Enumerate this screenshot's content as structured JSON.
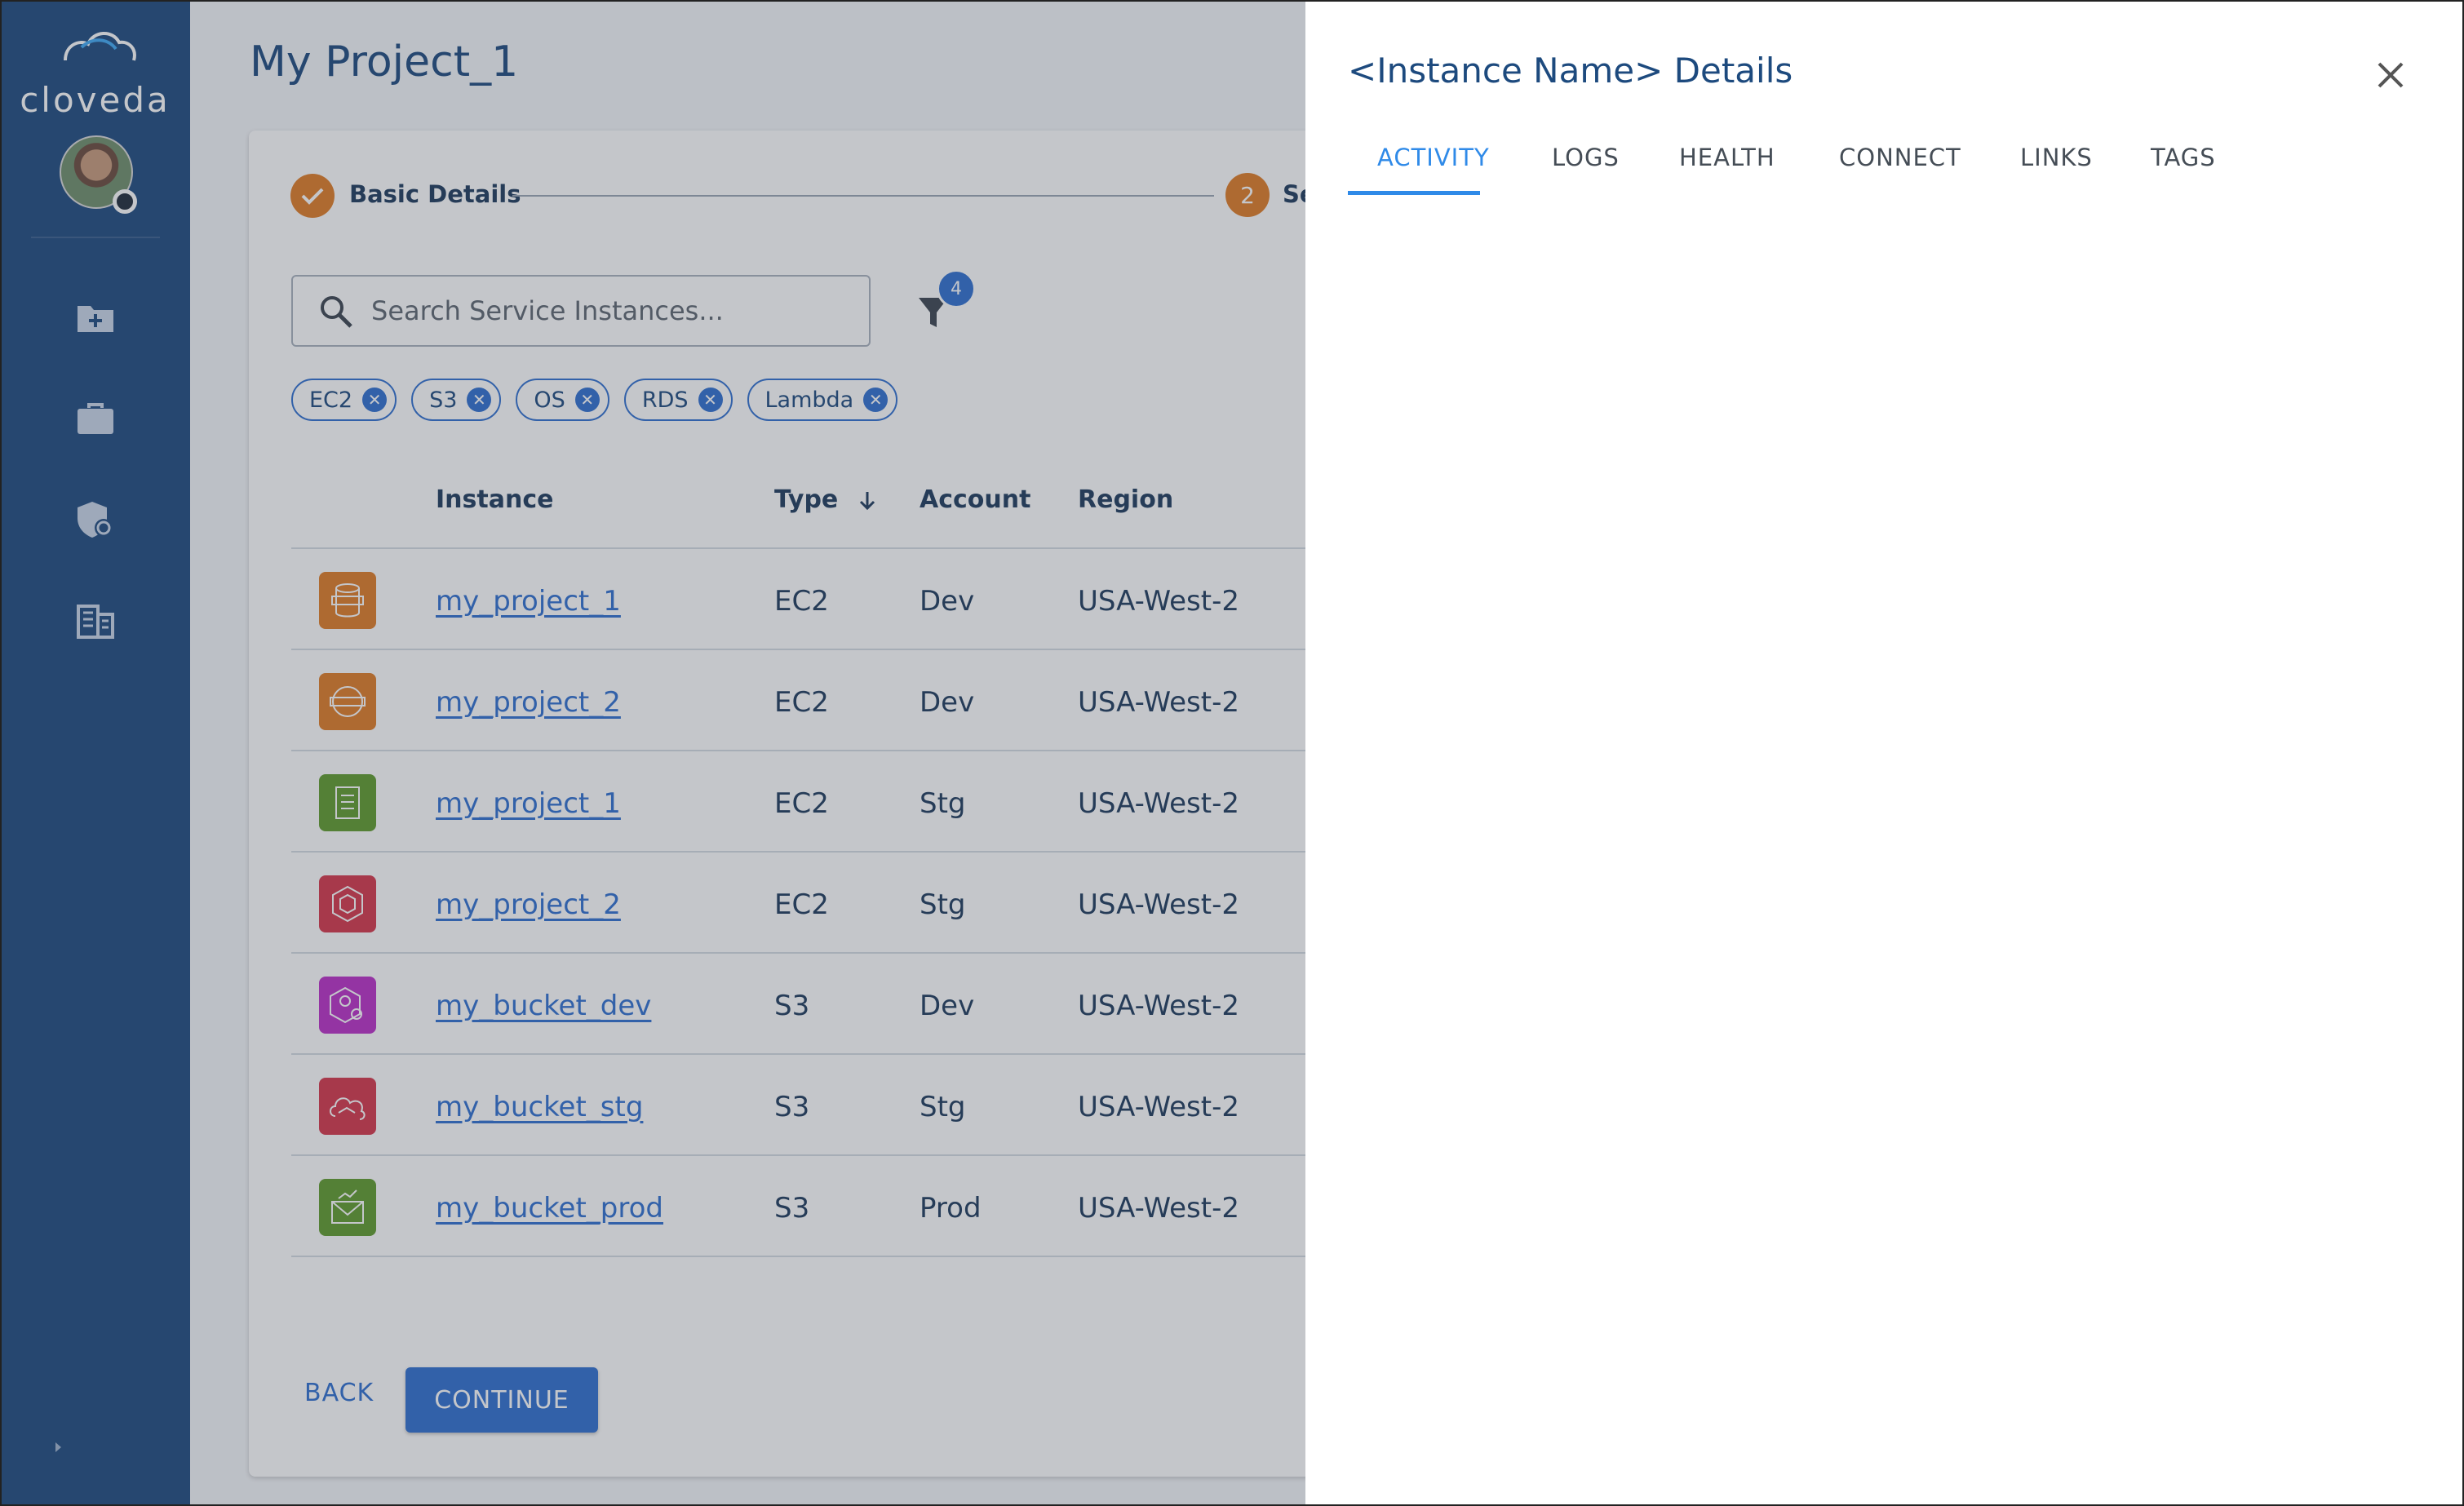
{
  "app": {
    "brand": "cloveda",
    "page_title": "My Project_1"
  },
  "stepper": {
    "step1_label": "Basic Details",
    "step2_number": "2",
    "step2_label": "Se"
  },
  "search": {
    "placeholder": "Search Service Instances..."
  },
  "filter": {
    "badge_count": "4"
  },
  "chips": [
    {
      "label": "EC2"
    },
    {
      "label": "S3"
    },
    {
      "label": "OS"
    },
    {
      "label": "RDS"
    },
    {
      "label": "Lambda"
    }
  ],
  "table": {
    "columns": {
      "instance": "Instance",
      "type": "Type",
      "account": "Account",
      "region": "Region"
    },
    "rows": [
      {
        "instance": "my_project_1",
        "type": "EC2",
        "account": "Dev",
        "region": "USA-West-2",
        "icon": "database-icon",
        "color": "#e07b25"
      },
      {
        "instance": "my_project_2",
        "type": "EC2",
        "account": "Dev",
        "region": "USA-West-2",
        "icon": "gateway-icon",
        "color": "#e07b25"
      },
      {
        "instance": "my_project_1",
        "type": "EC2",
        "account": "Stg",
        "region": "USA-West-2",
        "icon": "document-icon",
        "color": "#5f9b2c"
      },
      {
        "instance": "my_project_2",
        "type": "EC2",
        "account": "Stg",
        "region": "USA-West-2",
        "icon": "hexagon-icon",
        "color": "#d6364a"
      },
      {
        "instance": "my_bucket_dev",
        "type": "S3",
        "account": "Dev",
        "region": "USA-West-2",
        "icon": "user-settings-icon",
        "color": "#bb2fc7"
      },
      {
        "instance": "my_bucket_stg",
        "type": "S3",
        "account": "Stg",
        "region": "USA-West-2",
        "icon": "cloud-icon",
        "color": "#d6364a"
      },
      {
        "instance": "my_bucket_prod",
        "type": "S3",
        "account": "Prod",
        "region": "USA-West-2",
        "icon": "mail-chart-icon",
        "color": "#5f9b2c"
      }
    ]
  },
  "actions": {
    "back": "BACK",
    "continue": "CONTINUE"
  },
  "drawer": {
    "title": "<Instance Name> Details",
    "tabs": [
      {
        "label": "ACTIVITY",
        "active": true
      },
      {
        "label": "LOGS",
        "active": false
      },
      {
        "label": "HEALTH",
        "active": false
      },
      {
        "label": "CONNECT",
        "active": false
      },
      {
        "label": "LINKS",
        "active": false
      },
      {
        "label": "TAGS",
        "active": false
      }
    ]
  },
  "colors": {
    "sidebar": "#1d4a7e",
    "accent": "#2f6fd0",
    "step": "#e07b25"
  }
}
